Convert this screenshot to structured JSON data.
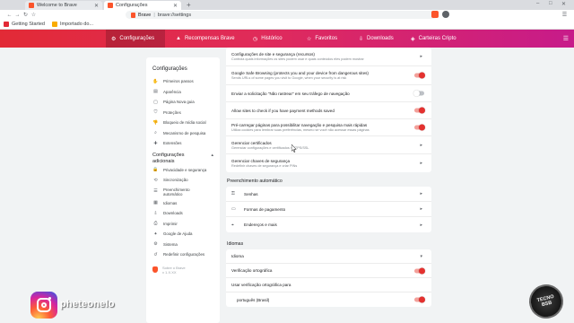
{
  "browser": {
    "tabs": [
      {
        "label": "Welcome to Brave",
        "active": false,
        "icon_color": "#fb542b"
      },
      {
        "label": "Configurações",
        "active": true,
        "icon_color": "#fb542b"
      }
    ],
    "new_tab_symbol": "+",
    "address": {
      "brand": "Brave",
      "separator": "|",
      "url": "brave://settings"
    },
    "bookmarks": [
      {
        "label": "Getting Started",
        "icon_color": "#e22a36"
      },
      {
        "label": "Importado do...",
        "icon_color": "#f9ab00"
      }
    ],
    "window_controls": [
      "–",
      "□",
      "✕"
    ]
  },
  "header": {
    "nav": [
      {
        "label": "Configurações",
        "icon": "gear-icon",
        "glyph": "⚙",
        "active": true
      },
      {
        "label": "Recompensas Brave",
        "icon": "triangle-icon",
        "glyph": "▲",
        "active": false
      },
      {
        "label": "Histórico",
        "icon": "history-icon",
        "glyph": "◷",
        "active": false
      },
      {
        "label": "Favoritos",
        "icon": "star-icon",
        "glyph": "☆",
        "active": false
      },
      {
        "label": "Downloads",
        "icon": "download-icon",
        "glyph": "⇩",
        "active": false
      },
      {
        "label": "Carteiras Cripto",
        "icon": "wallet-icon",
        "glyph": "◈",
        "active": false
      }
    ],
    "menu_icon": "☰",
    "colors": {
      "start": "#e22a36",
      "end": "#c71b8a"
    }
  },
  "sidebar": {
    "title": "Configurações",
    "items": [
      {
        "label": "Primeiros passos",
        "icon": "hand-icon",
        "glyph": "✋"
      },
      {
        "label": "Aparência",
        "icon": "appearance-icon",
        "glyph": "▤"
      },
      {
        "label": "Página Nova guia",
        "icon": "new-tab-icon",
        "glyph": "▢"
      },
      {
        "label": "Proteções",
        "icon": "shield-icon",
        "glyph": "⛉"
      },
      {
        "label": "Bloqueio de mídia social",
        "icon": "thumb-icon",
        "glyph": "👎"
      },
      {
        "label": "Mecanismo de pesquisa",
        "icon": "search-icon",
        "glyph": "⌕"
      },
      {
        "label": "Extensões",
        "icon": "puzzle-icon",
        "glyph": "✚"
      }
    ],
    "advanced": {
      "line1": "Configurações",
      "line2": "adicionais",
      "chevron": "▴"
    },
    "advanced_items": [
      {
        "label": "Privacidade e segurança",
        "icon": "lock-icon",
        "glyph": "🔒"
      },
      {
        "label": "Sincronização",
        "icon": "sync-icon",
        "glyph": "⟲"
      },
      {
        "label": "Preenchimento",
        "label2": "automático",
        "icon": "list-icon",
        "glyph": "☰"
      },
      {
        "label": "Idiomas",
        "icon": "language-icon",
        "glyph": "▦"
      },
      {
        "label": "Downloads",
        "icon": "download-icon",
        "glyph": "⇩"
      },
      {
        "label": "Imprimir",
        "icon": "print-icon",
        "glyph": "⎙"
      },
      {
        "label": "Google de Ajuda",
        "icon": "accessibility-icon",
        "glyph": "✦"
      },
      {
        "label": "Sistema",
        "icon": "system-icon",
        "glyph": "⚙"
      },
      {
        "label": "Redefinir configurações",
        "icon": "reset-icon",
        "glyph": "↺"
      }
    ],
    "footer": {
      "line1": "Sobre o Brave",
      "line2": "v 1.X.XX"
    }
  },
  "main": {
    "privacy_rows": [
      {
        "label": "Configurações de site e segurança (recursos)",
        "sub": "Controla quais informações os sites podem usar e quais conteúdos eles podem mostrar",
        "control": "chevron"
      },
      {
        "label": "Google Safe Browsing (protects you and your device from dangerous sites)",
        "sub": "Sends URLs of some pages you visit to Google, when your security is at risk",
        "control": "on"
      },
      {
        "label": "Enviar a solicitação \"Não rastrear\" em seu tráfego de navegação",
        "sub": "",
        "control": "off"
      },
      {
        "label": "Allow sites to check if you have payment methods saved",
        "sub": "",
        "control": "on"
      },
      {
        "label": "Pré-carregar páginas para possibilitar navegação e pesquisa mais rápidas",
        "sub": "Utiliza cookies para lembrar suas preferências, mesmo se você não acessar essas páginas",
        "control": "on"
      },
      {
        "label": "Gerenciar certificados",
        "sub": "Gerenciar configurações e certificados HTTPS/SSL",
        "control": "chevron"
      },
      {
        "label": "Gerenciar chaves de segurança",
        "sub": "Redefinir chaves de segurança e criar PINs",
        "control": "chevron"
      }
    ],
    "autofill": {
      "title": "Preenchimento automático",
      "rows": [
        {
          "label": "Senhas",
          "icon": "key-icon",
          "glyph": "⚿"
        },
        {
          "label": "Formas de pagamento",
          "icon": "card-icon",
          "glyph": "▭"
        },
        {
          "label": "Endereços e mais",
          "icon": "location-icon",
          "glyph": "⌖"
        }
      ]
    },
    "languages": {
      "title": "Idiomas",
      "rows": [
        {
          "label": "Idioma",
          "control": "chevron-down",
          "indent": false
        },
        {
          "label": "Verificação ortográfica",
          "control": "on",
          "indent": false
        },
        {
          "label": "Usar verificação ortográfica para",
          "control": "none",
          "indent": false
        },
        {
          "label": "português (Brasil)",
          "control": "on",
          "indent": true
        }
      ]
    }
  },
  "overlay": {
    "instagram_handle": "pheteonelo",
    "badge_line1": "TECNO",
    "badge_line2": "BSB",
    "toggle_on_color": "#e4312f"
  }
}
